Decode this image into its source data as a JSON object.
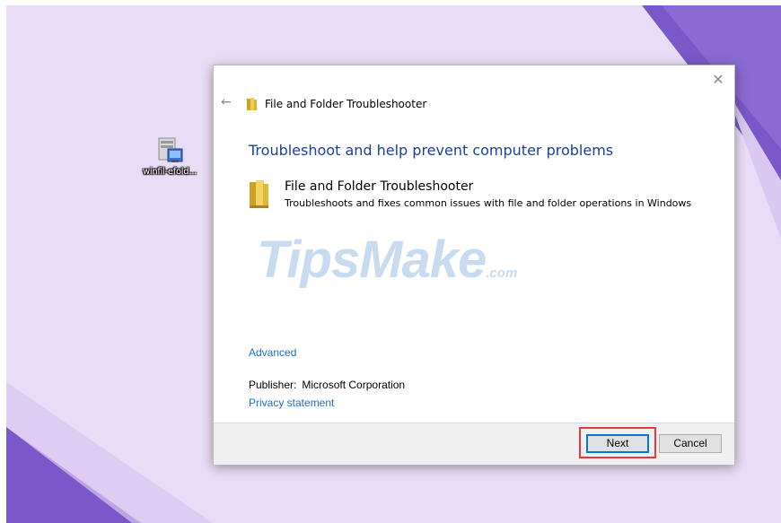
{
  "desktop": {
    "icon_label": "winfil-efold..."
  },
  "dialog": {
    "close_glyph": "✕",
    "back_glyph": "←",
    "window_title": "File and Folder Troubleshooter",
    "heading": "Troubleshoot and help prevent computer problems",
    "item": {
      "title": "File and Folder Troubleshooter",
      "description": "Troubleshoots and fixes common issues with file and folder operations in Windows"
    },
    "watermark": {
      "main": "TipsMake",
      "suffix": ".com"
    },
    "advanced_link": "Advanced",
    "publisher_label": "Publisher:",
    "publisher_value": "Microsoft Corporation",
    "privacy_link": "Privacy statement",
    "buttons": {
      "next": "Next",
      "cancel": "Cancel"
    }
  },
  "colors": {
    "desktop_bg": "#e9dcf6",
    "accent_shape": "#7a58c9",
    "heading": "#1b3f9a",
    "link": "#1a6fcf",
    "highlight_box": "#e5393b"
  },
  "icons": {
    "desktop_icon": "program-file-icon",
    "title_icon": "folder-icon",
    "item_icon": "folder-icon"
  }
}
